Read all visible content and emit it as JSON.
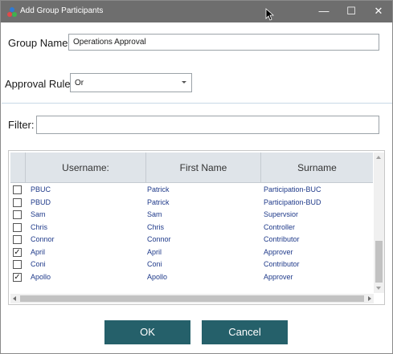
{
  "window": {
    "title": "Add Group Participants",
    "minimize_glyph": "—",
    "maximize_glyph": "☐",
    "close_glyph": "✕"
  },
  "form": {
    "group_name_label": "Group Name:",
    "group_name_value": "Operations Approval",
    "approval_rule_label": "Approval Rule:",
    "approval_rule_value": "Or",
    "filter_label": "Filter:",
    "filter_value": ""
  },
  "grid": {
    "columns": [
      "",
      "Username:",
      "First Name",
      "Surname"
    ],
    "rows": [
      {
        "checked": false,
        "username": "PBUC",
        "first_name": "Patrick",
        "surname": "Participation-BUC"
      },
      {
        "checked": false,
        "username": "PBUD",
        "first_name": "Patrick",
        "surname": "Participation-BUD"
      },
      {
        "checked": false,
        "username": "Sam",
        "first_name": "Sam",
        "surname": "Supervsior"
      },
      {
        "checked": false,
        "username": "Chris",
        "first_name": "Chris",
        "surname": "Controller"
      },
      {
        "checked": false,
        "username": "Connor",
        "first_name": "Connor",
        "surname": "Contributor"
      },
      {
        "checked": true,
        "username": "April",
        "first_name": "April",
        "surname": "Approver"
      },
      {
        "checked": false,
        "username": "Coni",
        "first_name": "Coni",
        "surname": "Contributor"
      },
      {
        "checked": true,
        "username": "Apollo",
        "first_name": "Apollo",
        "surname": "Approver"
      }
    ]
  },
  "buttons": {
    "ok_label": "OK",
    "cancel_label": "Cancel"
  },
  "colors": {
    "titlebar": "#6e6e6e",
    "button": "#25606a",
    "grid_text": "#1f3a8a",
    "header_bg": "#dfe4e9"
  }
}
